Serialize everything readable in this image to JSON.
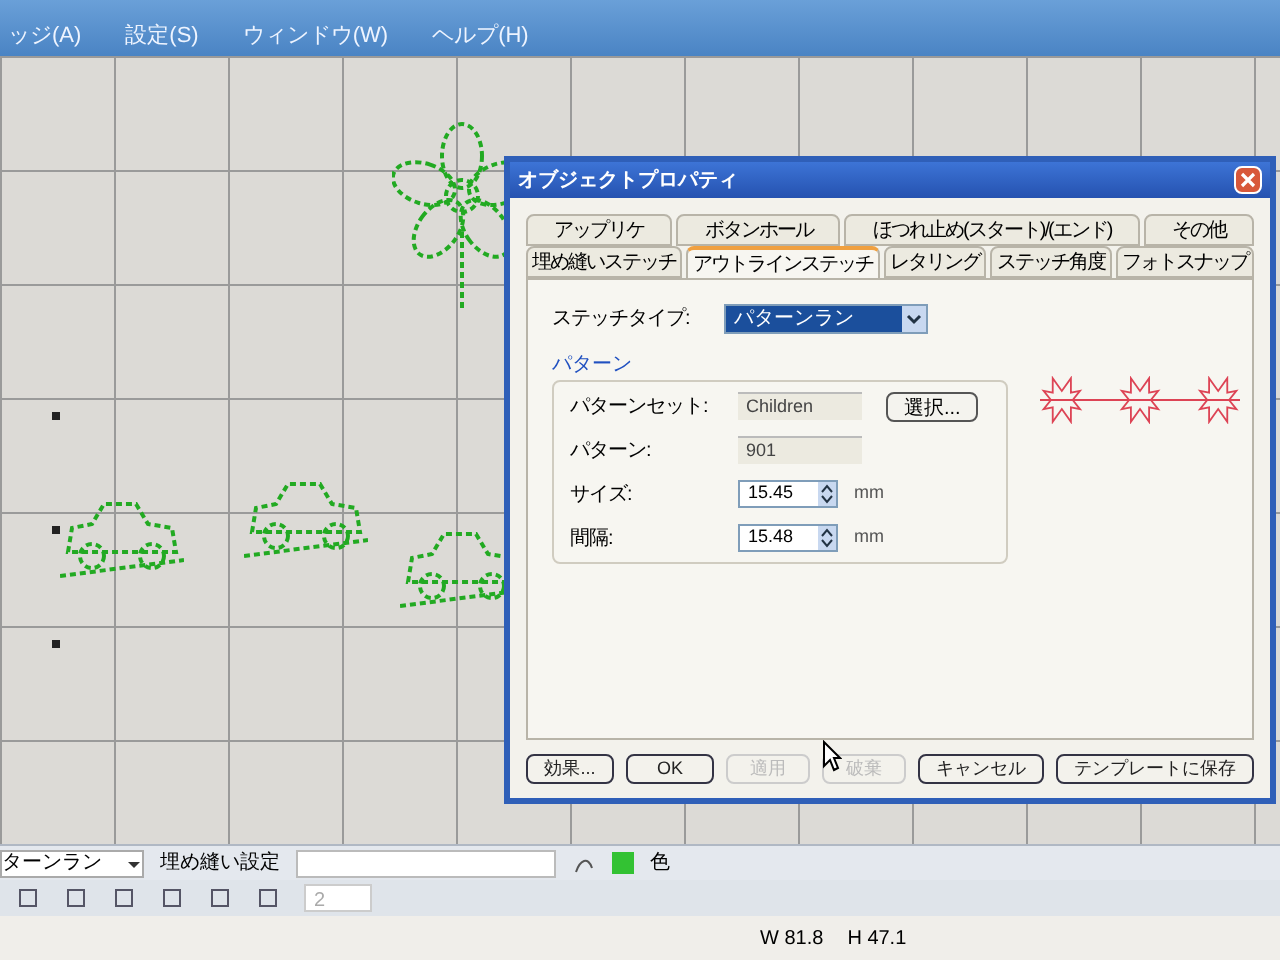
{
  "menu_bar": {
    "items": [
      "ッジ(A)",
      "設定(S)",
      "ウィンドウ(W)",
      "ヘルプ(H)"
    ]
  },
  "dialog": {
    "title": "オブジェクトプロパティ",
    "tab_rows": [
      [
        {
          "label": "アップリケ",
          "selected": false
        },
        {
          "label": "ボタンホール",
          "selected": false
        },
        {
          "label": "ほつれ止め(スタート)/(エンド)",
          "selected": false
        },
        {
          "label": "その他",
          "selected": false
        }
      ],
      [
        {
          "label": "埋め縫いステッチ",
          "selected": false
        },
        {
          "label": "アウトラインステッチ",
          "selected": true
        },
        {
          "label": "レタリング",
          "selected": false
        },
        {
          "label": "ステッチ角度",
          "selected": false
        },
        {
          "label": "フォトスナップ",
          "selected": false
        }
      ]
    ],
    "stitch_type": {
      "label": "ステッチタイプ:",
      "value": "パターンラン"
    },
    "pattern_group": {
      "title": "パターン",
      "fields": [
        {
          "kind": "readonly",
          "label": "パターンセット:",
          "value": "Children",
          "button": "選択..."
        },
        {
          "kind": "readonly",
          "label": "パターン:",
          "value": "901"
        },
        {
          "kind": "spin",
          "label": "サイズ:",
          "value": "15.45",
          "unit": "mm"
        },
        {
          "kind": "spin",
          "label": "間隔:",
          "value": "15.48",
          "unit": "mm"
        }
      ]
    },
    "buttons": [
      {
        "label": "効果...",
        "disabled": false
      },
      {
        "label": "OK",
        "disabled": false
      },
      {
        "label": "適用",
        "disabled": true
      },
      {
        "label": "破棄",
        "disabled": true
      },
      {
        "label": "キャンセル",
        "disabled": false
      },
      {
        "label": "テンプレートに保存",
        "disabled": false
      }
    ]
  },
  "toolbar": {
    "pattern_dropdown": "ターンラン",
    "fill_label": "埋め縫い設定",
    "color_label": "色",
    "spin_value": "2"
  },
  "status_bar": {
    "width": "W 81.8",
    "height": "H 47.1"
  }
}
